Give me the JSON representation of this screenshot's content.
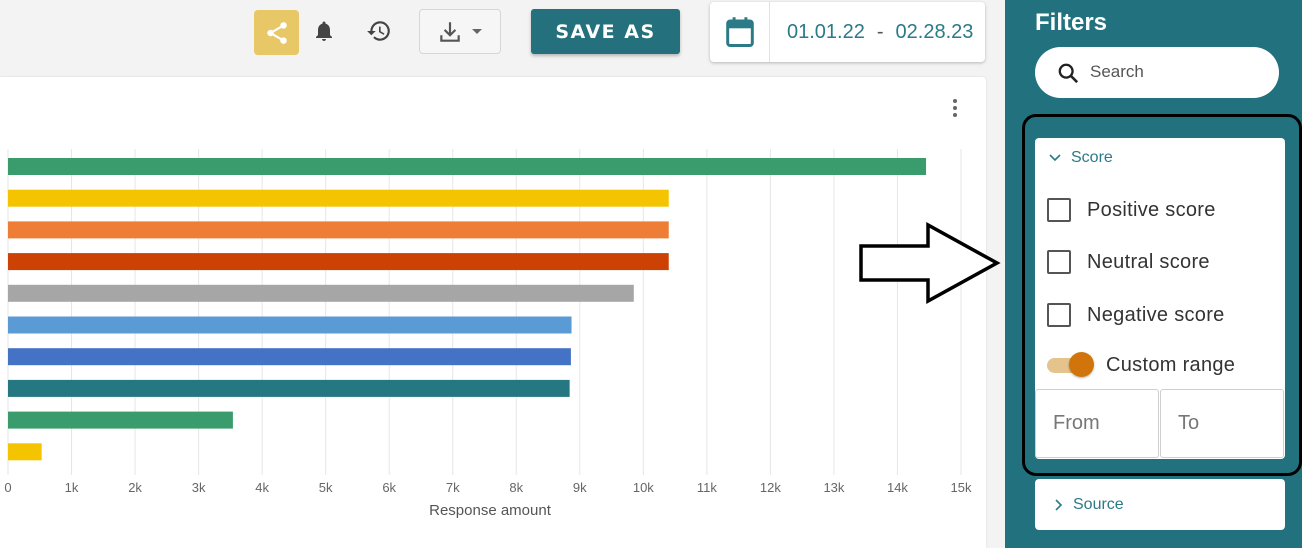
{
  "toolbar": {
    "save_as_label": "SAVE AS",
    "date_from": "01.01.22",
    "date_separator": "-",
    "date_to": "02.28.23",
    "share_color": "#e7c766"
  },
  "chart_data": {
    "type": "bar",
    "orientation": "horizontal",
    "xlabel": "Response amount",
    "xlim": [
      0,
      15000
    ],
    "xticks": [
      0,
      1000,
      2000,
      3000,
      4000,
      5000,
      6000,
      7000,
      8000,
      9000,
      10000,
      11000,
      12000,
      13000,
      14000,
      15000
    ],
    "xtick_labels": [
      "0",
      "1k",
      "2k",
      "3k",
      "4k",
      "5k",
      "6k",
      "7k",
      "8k",
      "9k",
      "10k",
      "11k",
      "12k",
      "13k",
      "14k",
      "15k"
    ],
    "grid": "vertical",
    "values": [
      14450,
      10400,
      10400,
      10400,
      9850,
      8870,
      8860,
      8840,
      3540,
      530
    ],
    "colors": [
      "#3a9c6c",
      "#f5c400",
      "#ee7d36",
      "#cc4205",
      "#a6a6a6",
      "#5b9bd5",
      "#4472c4",
      "#257782",
      "#3a9c6c",
      "#f5c400"
    ]
  },
  "sidebar": {
    "title": "Filters",
    "search_placeholder": "Search",
    "score": {
      "label": "Score",
      "options": [
        "Positive score",
        "Neutral score",
        "Negative score"
      ],
      "custom_range_label": "Custom range",
      "custom_range_on": true,
      "from_placeholder": "From",
      "to_placeholder": "To"
    },
    "source_label": "Source"
  },
  "icons": [
    "share-icon",
    "bell-icon",
    "history-icon",
    "download-icon",
    "caret-down-icon",
    "calendar-icon",
    "more-vert-icon",
    "search-icon",
    "chevron-down-icon",
    "chevron-right-icon",
    "arrow-right-icon"
  ]
}
